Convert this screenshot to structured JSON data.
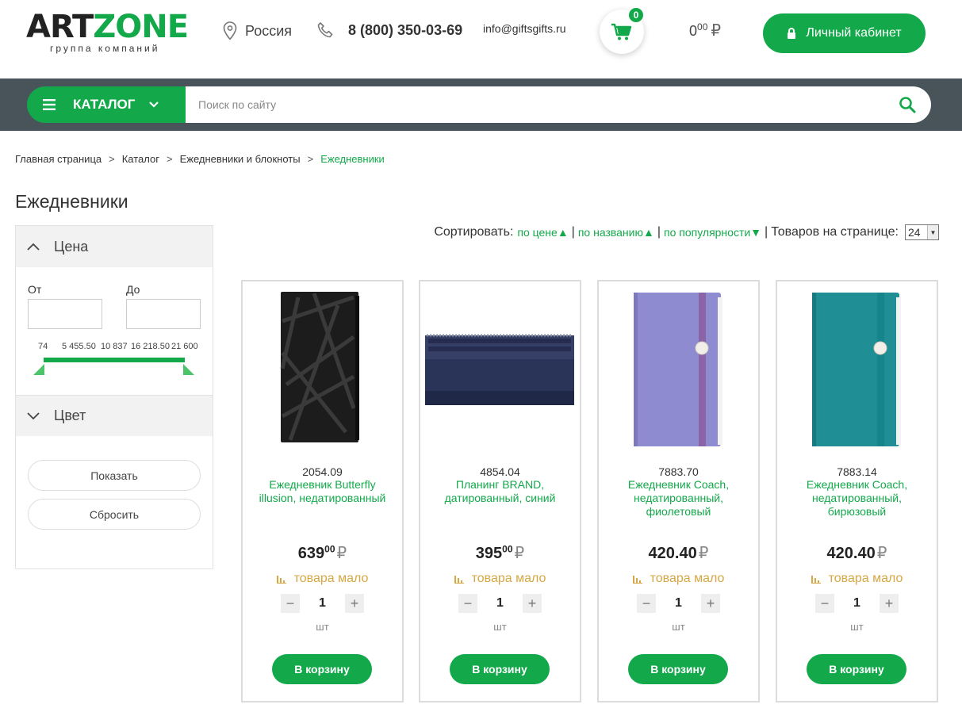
{
  "header": {
    "logo_art": "ART",
    "logo_zone": "ZONE",
    "logo_sub": "группа компаний",
    "region": "Россия",
    "phone": "8 (800) 350-03-69",
    "email": "info@giftsgifts.ru",
    "cart_count": "0",
    "cart_sum_int": "0",
    "cart_sum_dec": "00",
    "currency": "₽",
    "account_label": "Личный кабинет"
  },
  "nav": {
    "catalog_label": "КАТАЛОГ",
    "search_placeholder": "Поиск по сайту"
  },
  "breadcrumb": [
    "Главная страница",
    "Каталог",
    "Ежедневники и блокноты",
    "Ежедневники"
  ],
  "breadcrumb_sep": ">",
  "page_title": "Ежедневники",
  "filter": {
    "price_title": "Цена",
    "from_label": "От",
    "to_label": "До",
    "scale": [
      "74",
      "5 455.50",
      "10 837",
      "16 218.50",
      "21 600"
    ],
    "color_title": "Цвет",
    "show_label": "Показать",
    "reset_label": "Сбросить"
  },
  "sort": {
    "label": "Сортировать:",
    "by_price": "по цене▲",
    "by_name": "по названию▲",
    "by_popularity": "по популярности▼",
    "sep": "|",
    "per_page_label": "Товаров на странице:",
    "per_page_value": "24"
  },
  "colors": {
    "accent": "#13a94b",
    "navbar": "#485459",
    "stock": "#d6a744"
  },
  "products": [
    {
      "sku": "2054.09",
      "name": "Ежедневник Butterfly illusion, недатированный",
      "price_int": "639",
      "price_dec": "00",
      "stock": "товара мало",
      "qty": "1",
      "unit": "шт",
      "buy": "В корзину",
      "image": "black-notebook"
    },
    {
      "sku": "4854.04",
      "name": "Планинг BRAND, датированный, синий",
      "price_int": "395",
      "price_dec": "00",
      "stock": "товара мало",
      "qty": "1",
      "unit": "шт",
      "buy": "В корзину",
      "image": "navy-planner"
    },
    {
      "sku": "7883.70",
      "name": "Ежедневник Coach, недатированный, фиолетовый",
      "price_int": "420.40",
      "price_dec": "",
      "stock": "товара мало",
      "qty": "1",
      "unit": "шт",
      "buy": "В корзину",
      "image": "violet-notebook"
    },
    {
      "sku": "7883.14",
      "name": "Ежедневник Coach, недатированный, бирюзовый",
      "price_int": "420.40",
      "price_dec": "",
      "stock": "товара мало",
      "qty": "1",
      "unit": "шт",
      "buy": "В корзину",
      "image": "teal-notebook"
    }
  ]
}
